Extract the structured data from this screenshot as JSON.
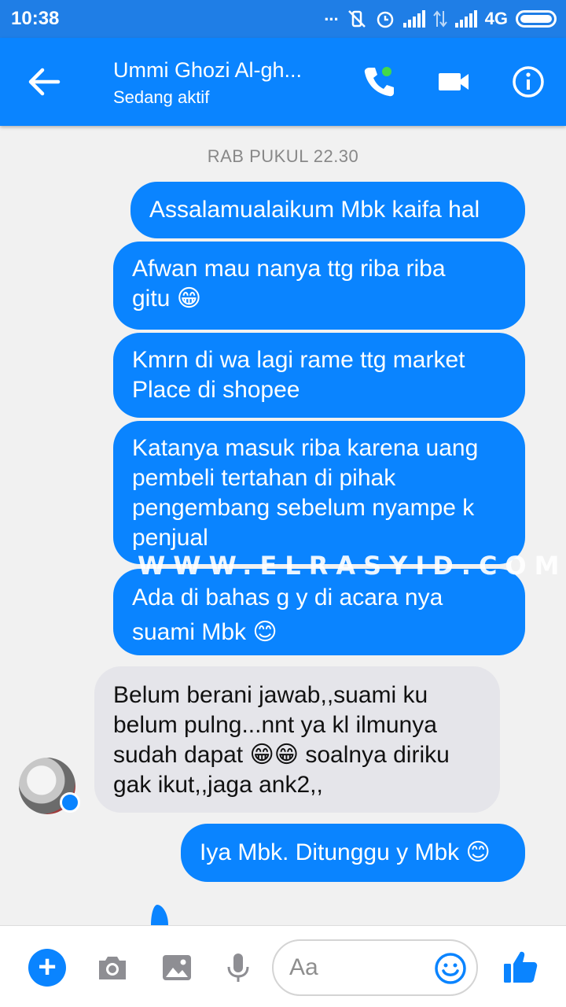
{
  "status_bar": {
    "time": "10:38",
    "dots": "...",
    "network": "4G"
  },
  "header": {
    "contact_name": "Ummi Ghozi Al-gh...",
    "presence": "Sedang aktif"
  },
  "conversation": {
    "timestamp": "RAB PUKUL 22.30",
    "messages": [
      {
        "sender": "me",
        "lines": [
          "Assalamualaikum Mbk kaifa hal"
        ]
      },
      {
        "sender": "me",
        "lines": [
          "Afwan mau nanya ttg riba riba",
          "gitu 😁"
        ]
      },
      {
        "sender": "me",
        "lines": [
          "Kmrn di wa lagi rame ttg market",
          "Place di shopee"
        ]
      },
      {
        "sender": "me",
        "lines": [
          "Katanya masuk riba karena uang",
          "pembeli tertahan di pihak",
          "pengembang sebelum nyampe k",
          "penjual"
        ]
      },
      {
        "sender": "me",
        "lines": [
          "Ada di bahas g y di acara nya",
          "suami Mbk 😊"
        ]
      },
      {
        "sender": "them",
        "lines": [
          "Belum berani jawab,,suami ku",
          "belum pulng...nnt ya kl ilmunya",
          "sudah dapat 😁😁 soalnya diriku",
          "gak ikut,,jaga ank2,,"
        ]
      },
      {
        "sender": "me",
        "lines": [
          "Iya Mbk. Ditunggu y Mbk 😊"
        ]
      }
    ],
    "watermark": "WWW.ELRASYID.COM"
  },
  "composer": {
    "placeholder": "Aa"
  },
  "colors": {
    "messenger_blue": "#0a84ff",
    "status_bar": "#1f7ee6",
    "incoming_bubble": "#e5e5ea",
    "online_dot": "#44d84a"
  },
  "icons": {
    "header": [
      "back-arrow-icon",
      "phone-icon",
      "video-camera-icon",
      "info-icon"
    ],
    "composer": [
      "plus-icon",
      "camera-icon",
      "image-icon",
      "microphone-icon",
      "emoji-icon",
      "thumbs-up-icon"
    ]
  }
}
